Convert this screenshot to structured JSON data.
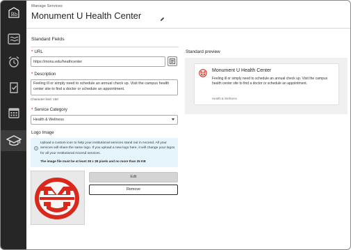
{
  "header": {
    "breadcrumb": "Manage Services",
    "title": "Monument U Health Center"
  },
  "form": {
    "section_title": "Standard Fields",
    "url": {
      "label": "URL",
      "value": "https://monu.edu/heathcenter"
    },
    "description": {
      "label": "Description",
      "value": "Feeling ill or simply need to schedule an annual check up. Visit the campus health center site to find a doctor or schedule an appointment.",
      "char_limit": "Character limit: 150"
    },
    "category": {
      "label": "Service Category",
      "selected": "Health & Wellness"
    },
    "logo": {
      "label": "Logo Image",
      "info_text": "Upload a custom icon to help your institutional services stand out in Ascend. All your services will share the same logo. If you upload a new logo here, it will change your logos for all your Institutional Ascend services.",
      "size_note": "The image file must be at least 38 x 38 pixels and no more than 25 KB",
      "edit_label": "Edit",
      "remove_label": "Remove"
    }
  },
  "preview": {
    "title": "Standard preview",
    "card": {
      "name": "Monument U Health Center",
      "description": "Feeling ill or simply need to schedule an annual check up. Visit the campus health center site to find a doctor or schedule an appointment.",
      "category": "Health & Wellness"
    }
  },
  "nav": {
    "items": [
      "bb-logo-icon",
      "activity-stream-icon",
      "alarm-clock-icon",
      "tasks-icon",
      "calendar-icon",
      "graduation-cap-icon"
    ],
    "active": "graduation-cap-icon"
  },
  "colors": {
    "nav_bg": "#262626",
    "logo_red": "#d9291c",
    "info_bg": "#e5f5fb"
  }
}
